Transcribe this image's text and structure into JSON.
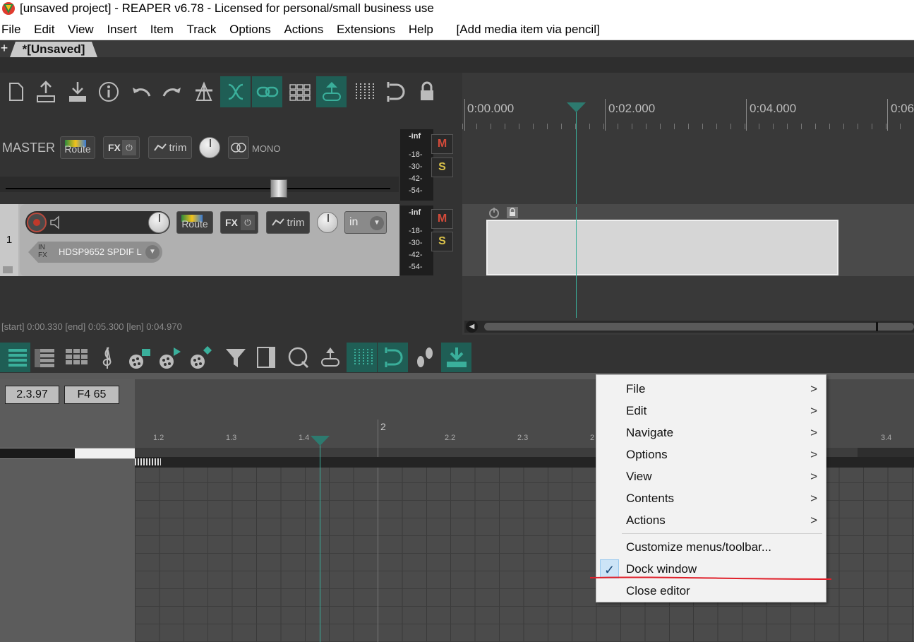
{
  "title_bar": {
    "text": "[unsaved project] - REAPER v6.78 - Licensed for personal/small business use"
  },
  "menu_bar": {
    "items": [
      "File",
      "Edit",
      "View",
      "Insert",
      "Item",
      "Track",
      "Options",
      "Actions",
      "Extensions",
      "Help"
    ],
    "hint": "[Add media item via pencil]"
  },
  "project_tab": {
    "plus": "+",
    "label": "*[Unsaved]"
  },
  "master": {
    "label": "MASTER",
    "route": "Route",
    "fx": "FX",
    "trim": "trim",
    "mono": "MONO",
    "meter_peak": "-inf",
    "meter_ticks": [
      "-18-",
      "-30-",
      "-42-",
      "-54-"
    ],
    "mute": "M",
    "solo": "S"
  },
  "track1": {
    "number": "1",
    "route": "Route",
    "fx": "FX",
    "trim": "trim",
    "input_mode": "in",
    "infx": [
      "IN",
      "FX"
    ],
    "input_name": "HDSP9652 SPDIF L",
    "meter_peak": "-inf",
    "meter_ticks": [
      "-18-",
      "-30-",
      "-42-",
      "-54-"
    ],
    "mute": "M",
    "solo": "S"
  },
  "timeline": {
    "labels": [
      "0:00.000",
      "0:02.000",
      "0:04.000",
      "0:06"
    ]
  },
  "status": {
    "selection": "[start] 0:00.330 [end] 0:05.300 [len] 0:04.970"
  },
  "midi_editor": {
    "position": "2.3.97",
    "note": "F4  65",
    "ruler_labels": [
      "1.2",
      "1.3",
      "1.4",
      "2",
      "2.2",
      "2.3",
      "2",
      "3.4"
    ]
  },
  "context_menu": {
    "items": [
      {
        "label": "File",
        "submenu": true
      },
      {
        "label": "Edit",
        "submenu": true
      },
      {
        "label": "Navigate",
        "submenu": true
      },
      {
        "label": "Options",
        "submenu": true
      },
      {
        "label": "View",
        "submenu": true
      },
      {
        "label": "Contents",
        "submenu": true
      },
      {
        "label": "Actions",
        "submenu": true
      },
      {
        "label": "Customize menus/toolbar...",
        "submenu": false
      },
      {
        "label": "Dock window",
        "submenu": false,
        "checked": true
      },
      {
        "label": "Close editor",
        "submenu": false
      }
    ],
    "arrow": ">",
    "check": "✓"
  },
  "toolbar": {
    "icons": [
      "new-project-icon",
      "open-project-icon",
      "save-project-icon",
      "project-info-icon",
      "undo-icon",
      "redo-icon",
      "metronome-icon",
      "ripple-edit-icon",
      "item-grouping-icon",
      "grid-icon",
      "snap-icon",
      "grid-lines-icon",
      "loop-icon",
      "lock-icon"
    ]
  },
  "midi_toolbar": {
    "icons": [
      "piano-roll-icon",
      "named-notes-icon",
      "drum-grid-icon",
      "notation-icon",
      "color-pitch-icon",
      "color-velocity-icon",
      "color-channel-icon",
      "filter-icon",
      "inline-editor-icon",
      "quantize-icon",
      "mute-link-icon",
      "midi-grid-icon",
      "midi-snap-icon",
      "step-input-icon",
      "dock-icon"
    ]
  },
  "colors": {
    "accent": "#1f5e55",
    "teal": "#3aaf9b",
    "background": "#333333",
    "menu_bg": "#f2f2f2",
    "annotation_red": "#e0202a"
  }
}
